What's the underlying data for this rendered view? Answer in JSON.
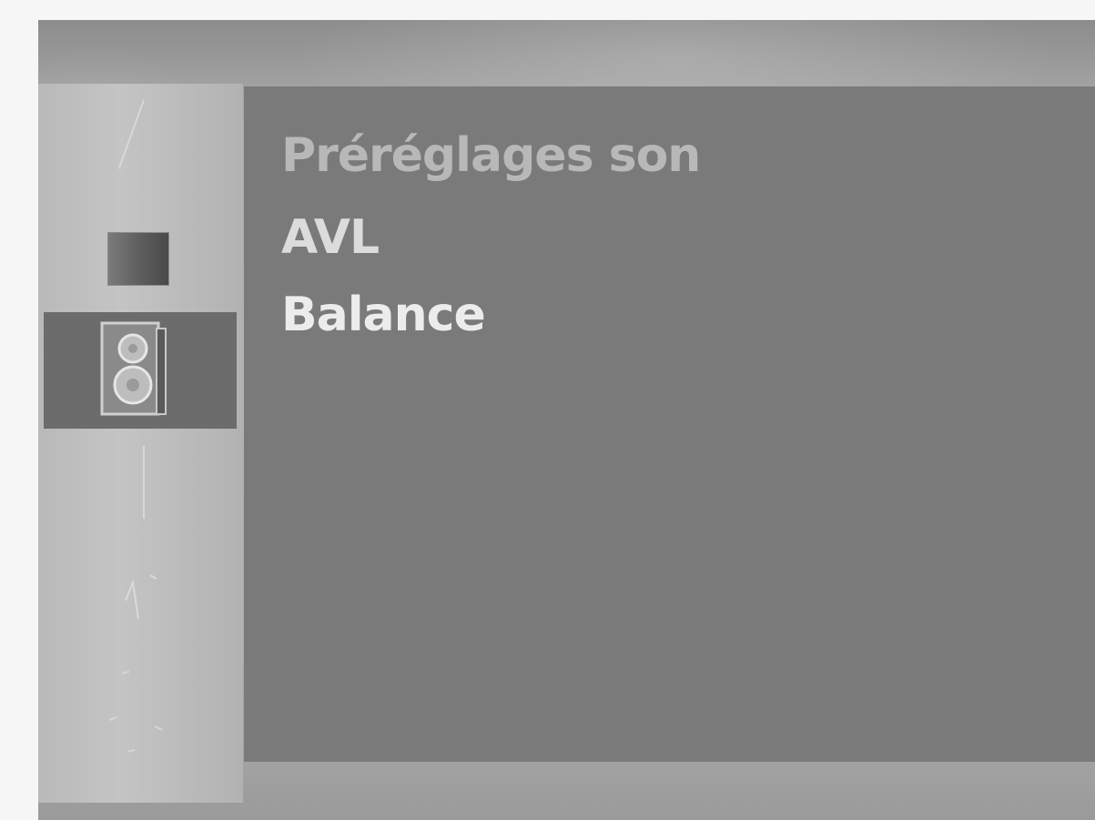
{
  "menu": {
    "items": [
      {
        "label": "Préréglages son"
      },
      {
        "label": "AVL"
      },
      {
        "label": "Balance"
      }
    ]
  },
  "sidebar": {
    "icons": [
      {
        "name": "picture-icon",
        "selected": false
      },
      {
        "name": "speaker-icon",
        "selected": true
      }
    ]
  },
  "colors": {
    "frame": "#a6a6a6",
    "panel": "#7a7a7a",
    "selected_tab": "#6c6c6c",
    "text": "#dcdcdc"
  }
}
